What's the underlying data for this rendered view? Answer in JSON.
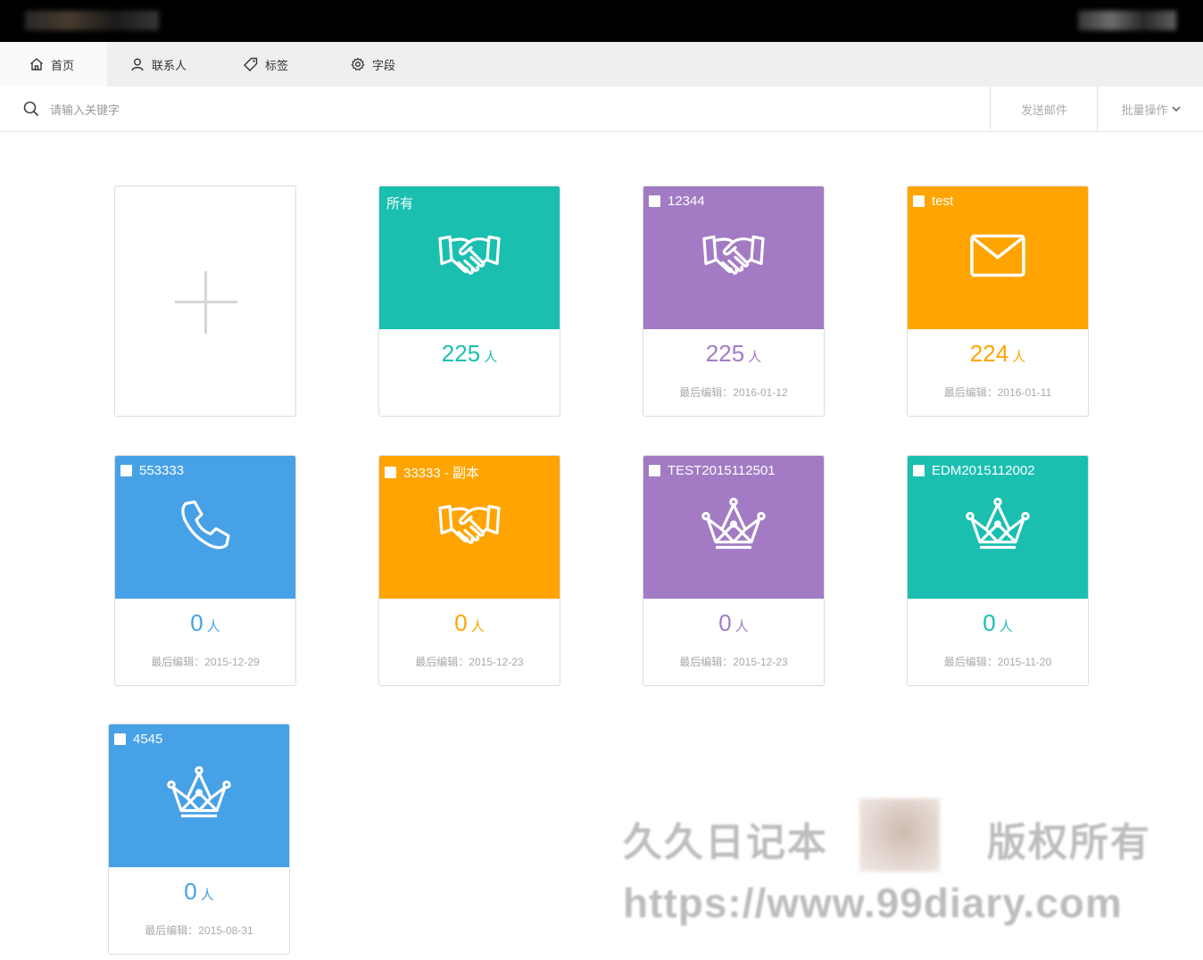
{
  "nav": {
    "items": [
      {
        "label": "首页",
        "icon": "home-icon"
      },
      {
        "label": "联系人",
        "icon": "user-icon"
      },
      {
        "label": "标签",
        "icon": "tag-icon"
      },
      {
        "label": "字段",
        "icon": "gear-icon"
      }
    ]
  },
  "search": {
    "placeholder": "请输入关键字",
    "send_email": "发送邮件",
    "batch": "批量操作"
  },
  "colors": {
    "teal": "#1abfb0",
    "purple": "#a27bc4",
    "orange": "#ffa400",
    "blue": "#47a1e6"
  },
  "cards": [
    {
      "title": "所有",
      "count": "225",
      "unit": "人",
      "date": "",
      "icon": "handshake-icon",
      "color": "teal"
    },
    {
      "title": "12344",
      "count": "225",
      "unit": "人",
      "date": "最后编辑：2016-01-12",
      "icon": "handshake-icon",
      "color": "purple"
    },
    {
      "title": "test",
      "count": "224",
      "unit": "人",
      "date": "最后编辑：2016-01-11",
      "icon": "envelope-icon",
      "color": "orange"
    },
    {
      "title": "553333",
      "count": "0",
      "unit": "人",
      "date": "最后编辑：2015-12-29",
      "icon": "phone-icon",
      "color": "blue"
    },
    {
      "title": "33333 - 副本",
      "count": "0",
      "unit": "人",
      "date": "最后编辑：2015-12-23",
      "icon": "handshake-icon",
      "color": "orange"
    },
    {
      "title": "TEST2015112501",
      "count": "0",
      "unit": "人",
      "date": "最后编辑：2015-12-23",
      "icon": "crown-icon",
      "color": "purple"
    },
    {
      "title": "EDM2015112002",
      "count": "0",
      "unit": "人",
      "date": "最后编辑：2015-11-20",
      "icon": "crown-icon",
      "color": "teal"
    },
    {
      "title": "4545",
      "count": "0",
      "unit": "人",
      "date": "最后编辑：2015-08-31",
      "icon": "crown-icon",
      "color": "blue"
    }
  ],
  "watermark": {
    "line1_left": "久久日记本",
    "line1_right": "版权所有",
    "line2": "https://www.99diary.com"
  }
}
